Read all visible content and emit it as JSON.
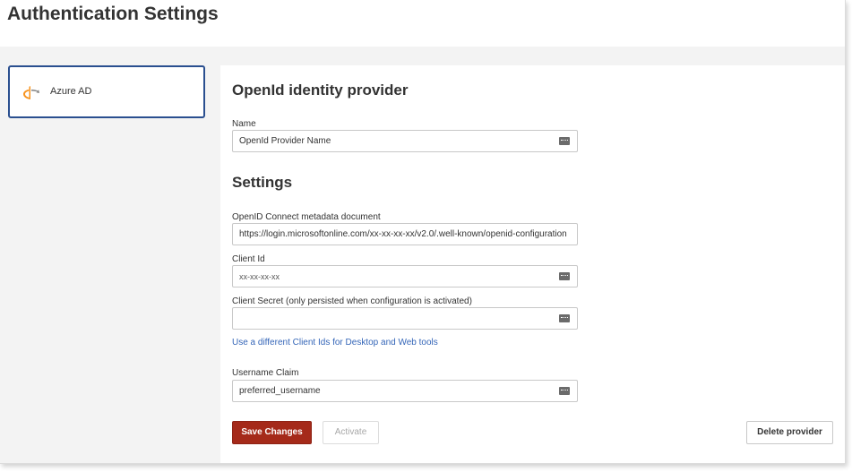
{
  "header": {
    "title": "Authentication Settings"
  },
  "sidebar": {
    "items": [
      {
        "label": "Azure AD",
        "icon": "openid-logo-icon",
        "selected": true
      }
    ]
  },
  "main": {
    "provider_section_title": "OpenId identity provider",
    "settings_section_title": "Settings",
    "fields": {
      "name": {
        "label": "Name",
        "value": "OpenId Provider Name"
      },
      "metadata": {
        "label": "OpenID Connect metadata document",
        "value": "https://login.microsoftonline.com/xx-xx-xx-xx/v2.0/.well-known/openid-configuration"
      },
      "client_id": {
        "label": "Client Id",
        "value": "xx-xx-xx-xx"
      },
      "client_secret": {
        "label": "Client Secret (only persisted when configuration is activated)",
        "value": ""
      },
      "username_claim": {
        "label": "Username Claim",
        "value": "preferred_username"
      }
    },
    "different_client_ids_link": "Use a different Client Ids for Desktop and Web tools"
  },
  "buttons": {
    "save": "Save Changes",
    "activate": "Activate",
    "delete": "Delete provider"
  },
  "colors": {
    "accent_save": "#a52a1a",
    "selected_border": "#2a4f8f",
    "link": "#3566b8",
    "openid_orange": "#f7931e"
  }
}
